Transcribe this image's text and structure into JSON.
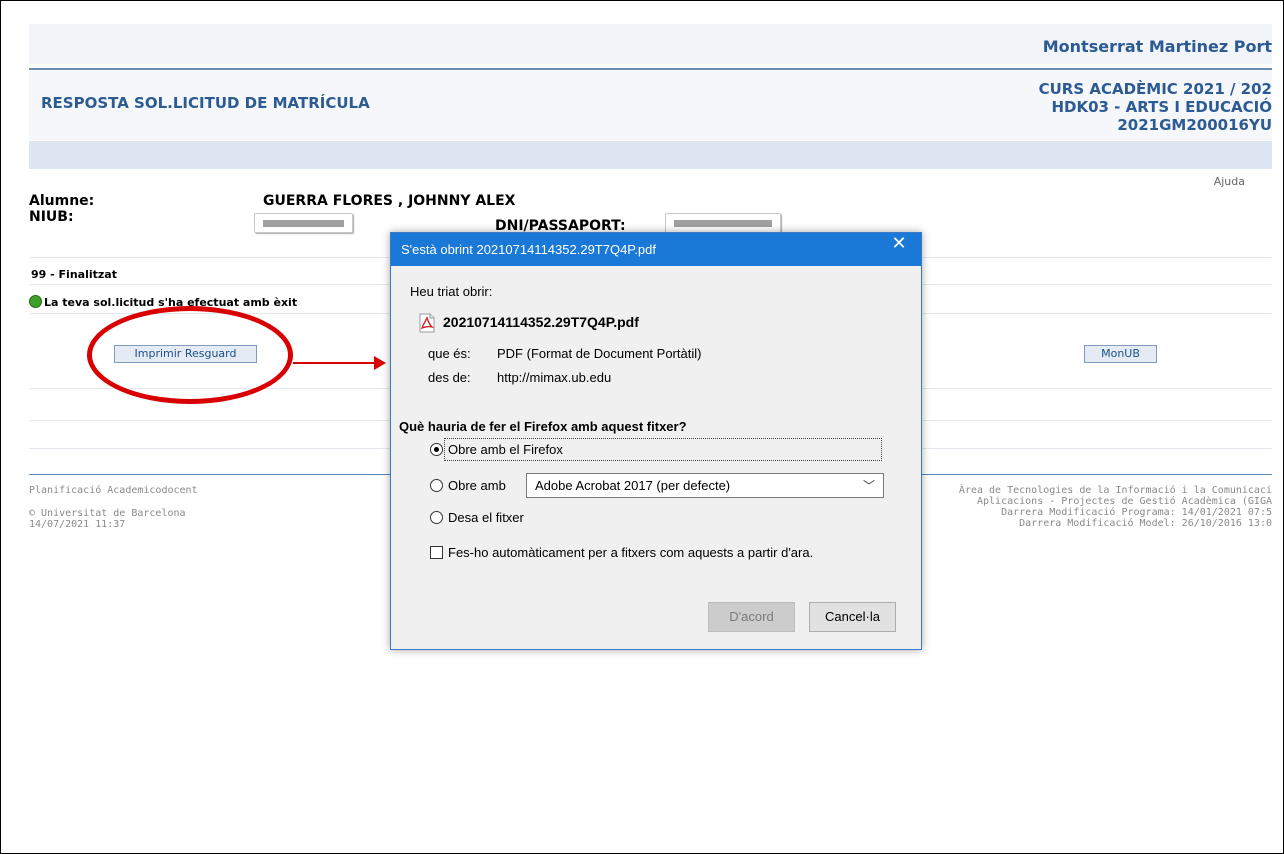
{
  "header": {
    "user_name": "Montserrat Martinez Port",
    "page_title": "RESPOSTA SOL.LICITUD DE MATRÍCULA",
    "course_line1": "CURS ACADÈMIC 2021 / 202",
    "course_line2": "HDK03 - ARTS I EDUCACIÓ",
    "course_line3": "2021GM200016YU",
    "help_link": "Ajuda"
  },
  "student": {
    "alumne_label": "Alumne:",
    "alumne_value": "GUERRA FLORES , JOHNNY ALEX",
    "niub_label": "NIUB:",
    "dni_label": "DNI/PASSAPORT:"
  },
  "status": {
    "code": "99 - Finalitzat",
    "message": "La teva sol.licitud s'ha efectuat amb èxit"
  },
  "buttons": {
    "print_receipt": "Imprimir Resguard",
    "monub": "MonUB"
  },
  "footer": {
    "left_line1": "Planificació Academicodocent",
    "left_line2": "© Universitat de Barcelona",
    "left_line3": "14/07/2021 11:37",
    "right_line1": "Àrea de Tecnologies de la Informació i la Comunicaci",
    "right_line2": "Aplicacions - Projectes de Gestió Acadèmica (GIGA",
    "right_line3": "Darrera Modificació Programa: 14/01/2021 07:5",
    "right_line4": "Darrera Modificació Model: 26/10/2016 13:0"
  },
  "dialog": {
    "title": "S'està obrint 20210714114352.29T7Q4P.pdf",
    "close_glyph": "✕",
    "intro": "Heu triat obrir:",
    "file_name": "20210714114352.29T7Q4P.pdf",
    "type_label": "que és:",
    "type_value": "PDF (Format de Document Portàtil)",
    "from_label": "des de:",
    "from_value": "http://mimax.ub.edu",
    "question": "Què hauria de fer el Firefox amb aquest fitxer?",
    "option_open_firefox": "Obre amb el Firefox",
    "option_open_with": "Obre amb",
    "open_with_app": "Adobe Acrobat 2017 (per defecte)",
    "option_save": "Desa el fitxer",
    "auto_checkbox": "Fes-ho automàticament per a fitxers com aquests a partir d'ara.",
    "ok_button": "D'acord",
    "cancel_button": "Cancel·la",
    "selected_option": "open_firefox",
    "auto_checked": false
  },
  "icons": {
    "status_icon": "success-dot-icon",
    "file_icon": "pdf-file-icon",
    "close_icon": "close-icon",
    "dropdown_icon": "chevron-down-icon"
  },
  "colors": {
    "brand_blue": "#2c5a92",
    "dialog_title_bar": "#1a78d7",
    "annotation_red": "#d80000",
    "success_green": "#3f9f2a"
  }
}
